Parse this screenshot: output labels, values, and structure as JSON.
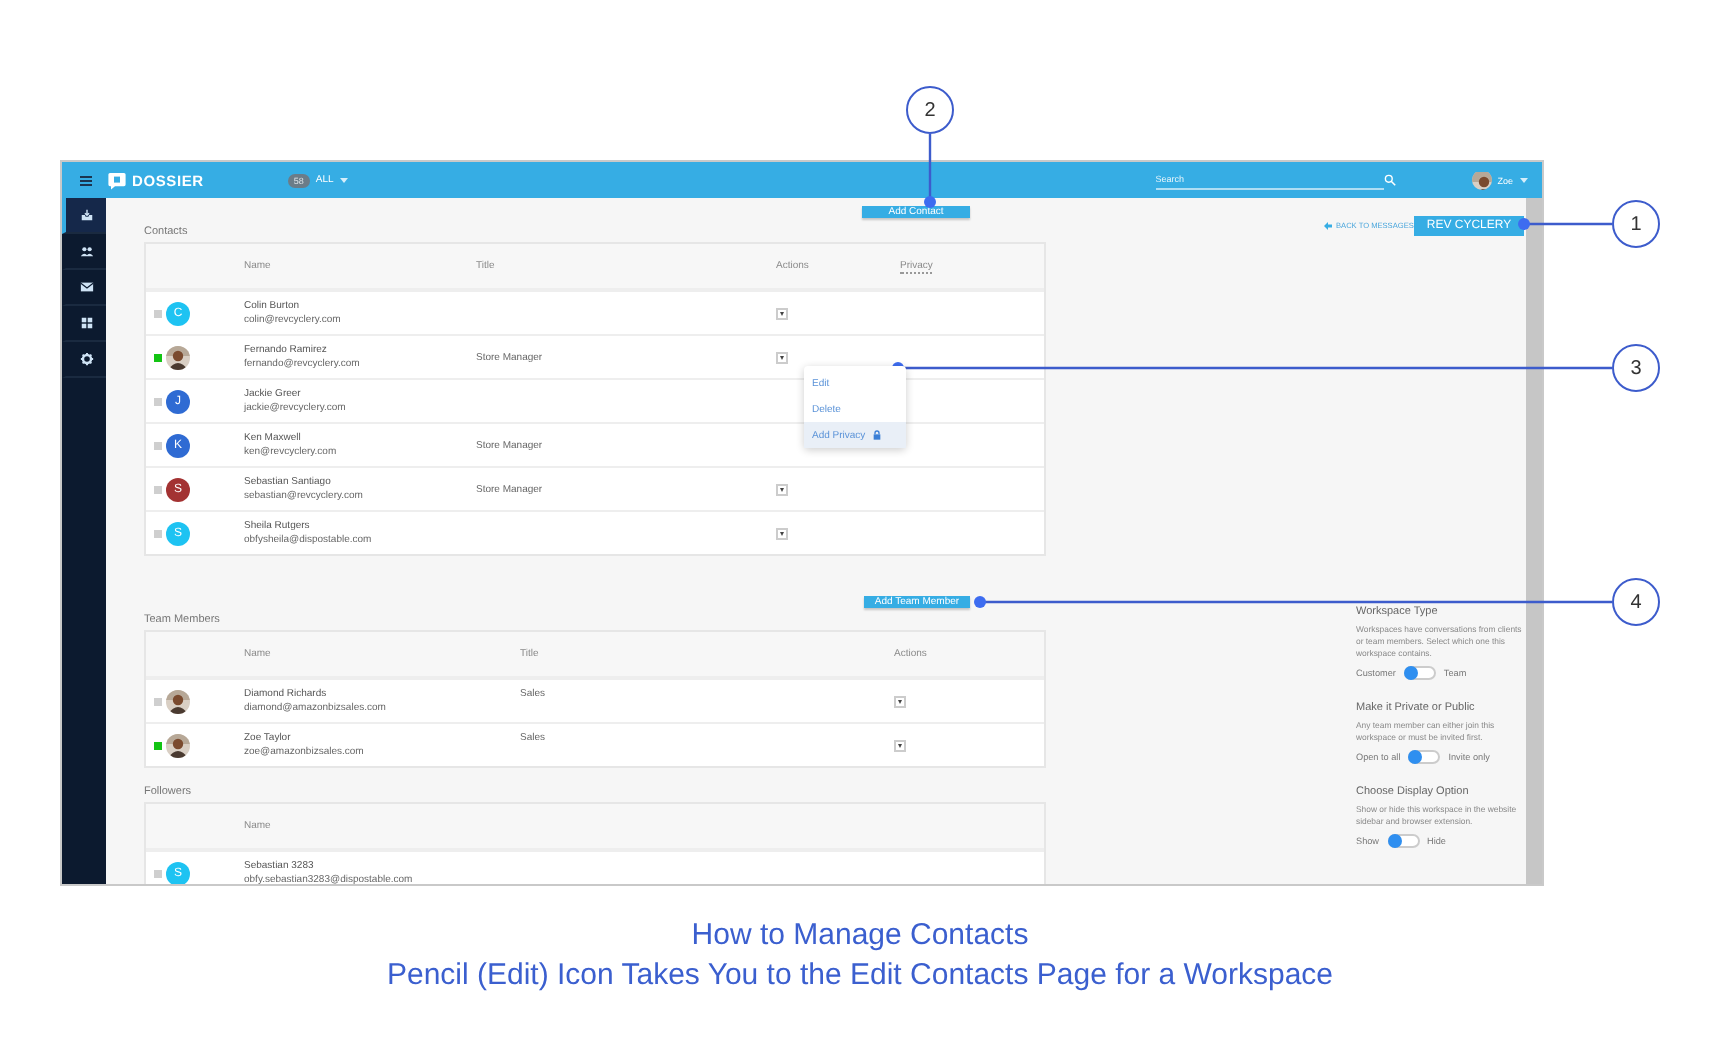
{
  "top_bar": {
    "brand": "DOSSIER",
    "count_badge": "58",
    "filter": "ALL",
    "search": {
      "placeholder": "Search"
    },
    "user": "Zoe"
  },
  "sidebar": {
    "items": [
      {
        "kind": "inbox",
        "selected": true
      },
      {
        "kind": "people",
        "selected": false
      },
      {
        "kind": "mail",
        "selected": false
      },
      {
        "kind": "grid",
        "selected": false
      },
      {
        "kind": "gear",
        "selected": false
      }
    ]
  },
  "add_contact_button": "Add Contact",
  "back_link": "BACK TO MESSAGES",
  "workspace_button": "REV CYCLERY",
  "contacts": {
    "label": "Contacts",
    "columns": [
      "Name",
      "Title",
      "Actions",
      "Privacy"
    ],
    "rows": [
      {
        "online": false,
        "avatar": {
          "kind": "letter",
          "letter": "C",
          "color": "#1ec3f2"
        },
        "name": "Colin Burton",
        "email": "colin@revcyclery.com",
        "actions_menu": true
      },
      {
        "online": true,
        "name": "Fernando Ramirez",
        "email": "fernando@revcyclery.com",
        "title": "Store Manager",
        "actions_menu": true,
        "menu": {
          "items": [
            {
              "label": "Edit",
              "selected": false
            },
            {
              "label": "Delete",
              "selected": false
            },
            {
              "label": "Add Privacy",
              "selected": true,
              "kind": "lock"
            }
          ]
        }
      },
      {
        "online": false,
        "avatar": {
          "kind": "letter",
          "letter": "J",
          "color": "#2f6bd3"
        },
        "name": "Jackie Greer",
        "email": "jackie@revcyclery.com",
        "actions_menu": false
      },
      {
        "online": false,
        "avatar": {
          "kind": "letter",
          "letter": "K",
          "color": "#2f6bd3"
        },
        "name": "Ken Maxwell",
        "email": "ken@revcyclery.com",
        "title": "Store Manager",
        "actions_menu": false
      },
      {
        "online": false,
        "avatar": {
          "kind": "letter",
          "letter": "S",
          "color": "#a33232"
        },
        "name": "Sebastian Santiago",
        "email": "sebastian@revcyclery.com",
        "title": "Store Manager",
        "actions_menu": true
      },
      {
        "online": false,
        "avatar": {
          "kind": "letter",
          "letter": "S",
          "color": "#1ec3f2"
        },
        "name": "Sheila Rutgers",
        "email": "obfysheila@dispostable.com",
        "actions_menu": true
      }
    ]
  },
  "add_team_member_button": "Add Team Member",
  "team_members": {
    "label": "Team Members",
    "columns": [
      "Name",
      "Title",
      "Actions"
    ],
    "rows": [
      {
        "online": false,
        "name": "Diamond Richards",
        "email": "diamond@amazonbizsales.com",
        "title": "Sales",
        "actions_menu": true
      },
      {
        "online": true,
        "name": "Zoe Taylor",
        "email": "zoe@amazonbizsales.com",
        "title": "Sales",
        "actions_menu": true
      }
    ]
  },
  "followers": {
    "label": "Followers",
    "columns": [
      "Name"
    ],
    "rows": [
      {
        "online": false,
        "avatar": {
          "kind": "letter",
          "letter": "S",
          "color": "#1ec3f2"
        },
        "name": "Sebastian 3283",
        "email": "obfy.sebastian3283@dispostable.com"
      }
    ]
  },
  "settings": [
    {
      "title": "Workspace Type",
      "description": "Workspaces have conversations from clients or team members. Select which one this workspace contains.",
      "off_label": "Customer",
      "on_label": "Team",
      "on": false
    },
    {
      "title": "Make it Private or Public",
      "description": "Any team member can either join this workspace or must be invited first.",
      "off_label": "Open to all",
      "on_label": "Invite only",
      "on": false
    },
    {
      "title": "Choose Display Option",
      "description": "Show or hide this workspace in the website sidebar and browser extension.",
      "off_label": "Show",
      "on_label": "Hide",
      "on": false
    }
  ],
  "callouts": [
    "1",
    "2",
    "3",
    "4"
  ],
  "caption": {
    "title": "How to Manage Contacts",
    "subtitle": "Pencil (Edit) Icon Takes You to the Edit Contacts Page for a Workspace"
  }
}
